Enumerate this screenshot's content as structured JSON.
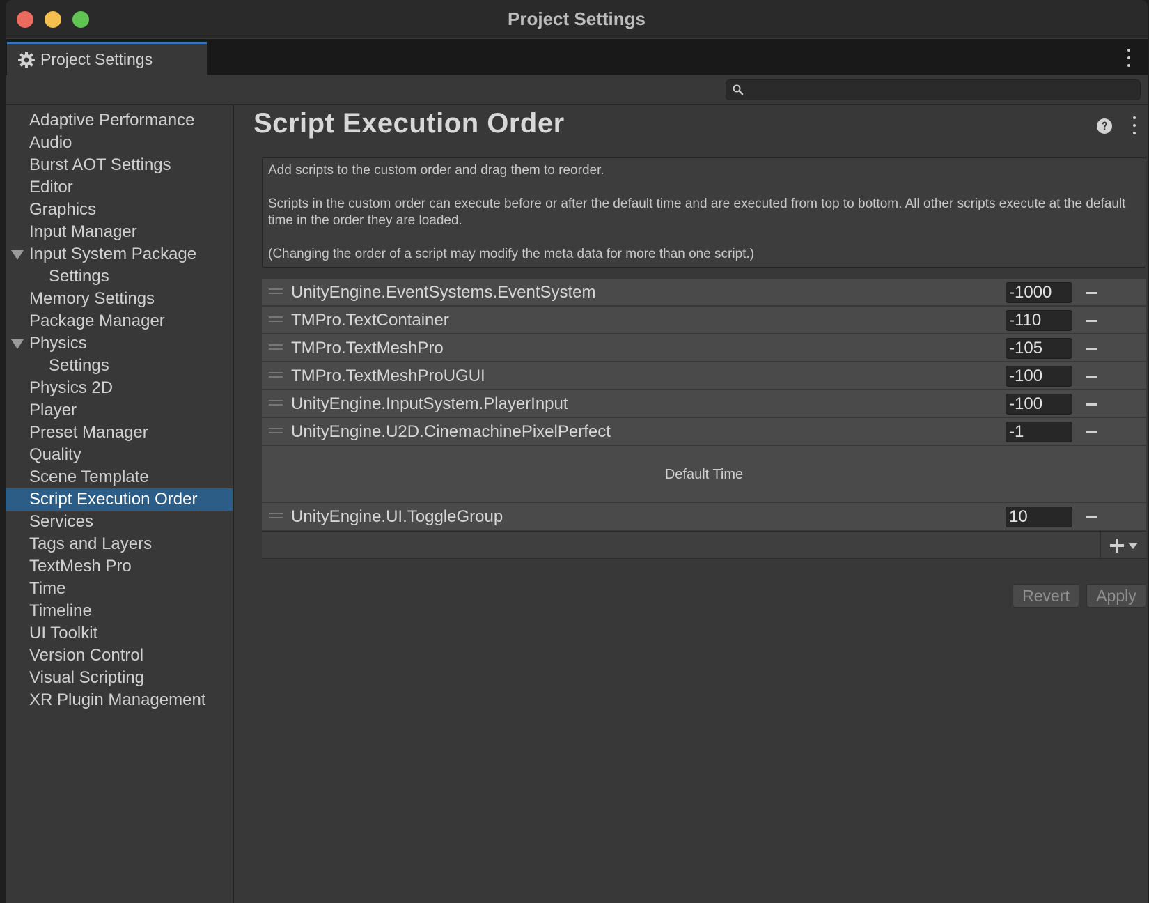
{
  "window": {
    "title": "Project Settings"
  },
  "tab": {
    "label": "Project Settings",
    "icon": "gear-icon"
  },
  "search": {
    "placeholder": "",
    "value": ""
  },
  "sidebar": {
    "items": [
      {
        "label": "Adaptive Performance",
        "level": 0
      },
      {
        "label": "Audio",
        "level": 0
      },
      {
        "label": "Burst AOT Settings",
        "level": 0
      },
      {
        "label": "Editor",
        "level": 0
      },
      {
        "label": "Graphics",
        "level": 0
      },
      {
        "label": "Input Manager",
        "level": 0
      },
      {
        "label": "Input System Package",
        "level": 0,
        "expanded": true
      },
      {
        "label": "Settings",
        "level": 1
      },
      {
        "label": "Memory Settings",
        "level": 0
      },
      {
        "label": "Package Manager",
        "level": 0
      },
      {
        "label": "Physics",
        "level": 0,
        "expanded": true
      },
      {
        "label": "Settings",
        "level": 1
      },
      {
        "label": "Physics 2D",
        "level": 0
      },
      {
        "label": "Player",
        "level": 0
      },
      {
        "label": "Preset Manager",
        "level": 0
      },
      {
        "label": "Quality",
        "level": 0
      },
      {
        "label": "Scene Template",
        "level": 0
      },
      {
        "label": "Script Execution Order",
        "level": 0,
        "selected": true
      },
      {
        "label": "Services",
        "level": 0
      },
      {
        "label": "Tags and Layers",
        "level": 0
      },
      {
        "label": "TextMesh Pro",
        "level": 0
      },
      {
        "label": "Time",
        "level": 0
      },
      {
        "label": "Timeline",
        "level": 0
      },
      {
        "label": "UI Toolkit",
        "level": 0
      },
      {
        "label": "Version Control",
        "level": 0
      },
      {
        "label": "Visual Scripting",
        "level": 0
      },
      {
        "label": "XR Plugin Management",
        "level": 0
      }
    ]
  },
  "main": {
    "title": "Script Execution Order",
    "help": {
      "line1": "Add scripts to the custom order and drag them to reorder.",
      "line2": "Scripts in the custom order can execute before or after the default time and are executed from top to bottom. All other scripts execute at the default time in the order they are loaded.",
      "line3": "(Changing the order of a script may modify the meta data for more than one script.)"
    },
    "scripts_before": [
      {
        "name": "UnityEngine.EventSystems.EventSystem",
        "order": "-1000"
      },
      {
        "name": "TMPro.TextContainer",
        "order": "-110"
      },
      {
        "name": "TMPro.TextMeshPro",
        "order": "-105"
      },
      {
        "name": "TMPro.TextMeshProUGUI",
        "order": "-100"
      },
      {
        "name": "UnityEngine.InputSystem.PlayerInput",
        "order": "-100"
      },
      {
        "name": "UnityEngine.U2D.CinemachinePixelPerfect",
        "order": "-1"
      }
    ],
    "default_time_label": "Default Time",
    "scripts_after": [
      {
        "name": "UnityEngine.UI.ToggleGroup",
        "order": "10"
      }
    ],
    "buttons": {
      "revert": "Revert",
      "apply": "Apply"
    }
  },
  "colors": {
    "selection": "#2c5d87",
    "tab_accent": "#3a79bb",
    "background": "#383838"
  }
}
